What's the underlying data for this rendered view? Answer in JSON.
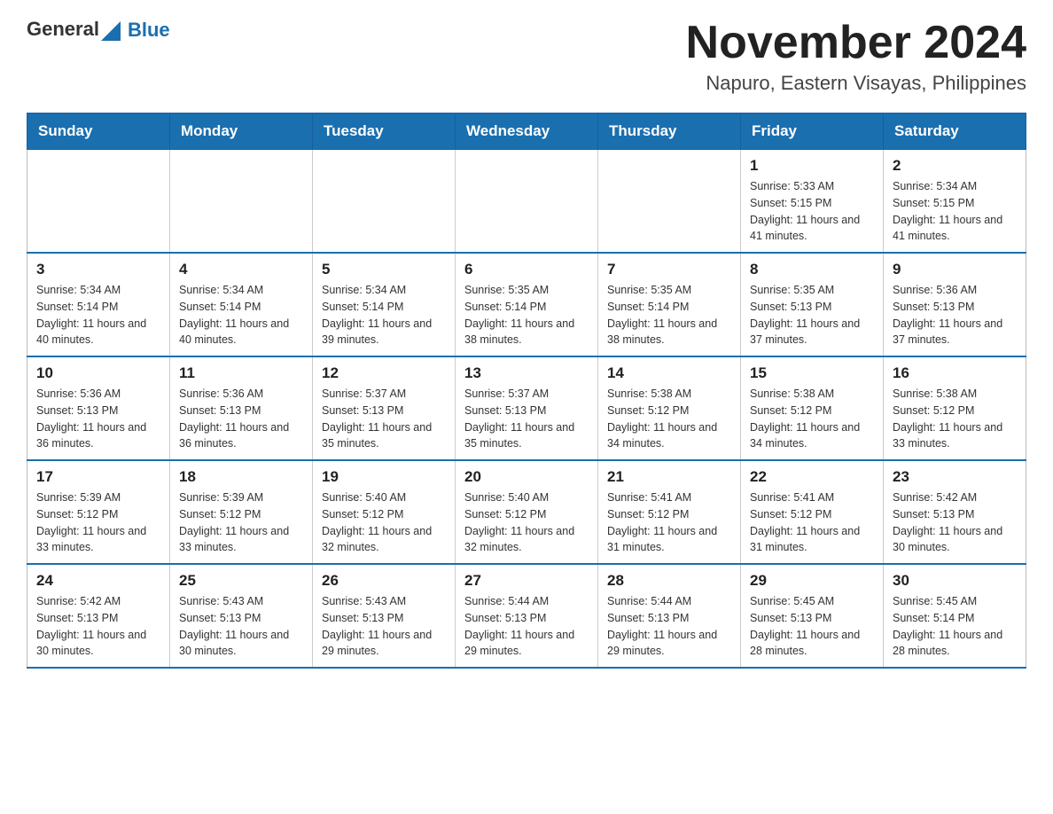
{
  "header": {
    "logo": {
      "general": "General",
      "blue": "Blue"
    },
    "title": "November 2024",
    "location": "Napuro, Eastern Visayas, Philippines"
  },
  "calendar": {
    "days_of_week": [
      "Sunday",
      "Monday",
      "Tuesday",
      "Wednesday",
      "Thursday",
      "Friday",
      "Saturday"
    ],
    "weeks": [
      [
        {
          "day": "",
          "info": ""
        },
        {
          "day": "",
          "info": ""
        },
        {
          "day": "",
          "info": ""
        },
        {
          "day": "",
          "info": ""
        },
        {
          "day": "",
          "info": ""
        },
        {
          "day": "1",
          "info": "Sunrise: 5:33 AM\nSunset: 5:15 PM\nDaylight: 11 hours and 41 minutes."
        },
        {
          "day": "2",
          "info": "Sunrise: 5:34 AM\nSunset: 5:15 PM\nDaylight: 11 hours and 41 minutes."
        }
      ],
      [
        {
          "day": "3",
          "info": "Sunrise: 5:34 AM\nSunset: 5:14 PM\nDaylight: 11 hours and 40 minutes."
        },
        {
          "day": "4",
          "info": "Sunrise: 5:34 AM\nSunset: 5:14 PM\nDaylight: 11 hours and 40 minutes."
        },
        {
          "day": "5",
          "info": "Sunrise: 5:34 AM\nSunset: 5:14 PM\nDaylight: 11 hours and 39 minutes."
        },
        {
          "day": "6",
          "info": "Sunrise: 5:35 AM\nSunset: 5:14 PM\nDaylight: 11 hours and 38 minutes."
        },
        {
          "day": "7",
          "info": "Sunrise: 5:35 AM\nSunset: 5:14 PM\nDaylight: 11 hours and 38 minutes."
        },
        {
          "day": "8",
          "info": "Sunrise: 5:35 AM\nSunset: 5:13 PM\nDaylight: 11 hours and 37 minutes."
        },
        {
          "day": "9",
          "info": "Sunrise: 5:36 AM\nSunset: 5:13 PM\nDaylight: 11 hours and 37 minutes."
        }
      ],
      [
        {
          "day": "10",
          "info": "Sunrise: 5:36 AM\nSunset: 5:13 PM\nDaylight: 11 hours and 36 minutes."
        },
        {
          "day": "11",
          "info": "Sunrise: 5:36 AM\nSunset: 5:13 PM\nDaylight: 11 hours and 36 minutes."
        },
        {
          "day": "12",
          "info": "Sunrise: 5:37 AM\nSunset: 5:13 PM\nDaylight: 11 hours and 35 minutes."
        },
        {
          "day": "13",
          "info": "Sunrise: 5:37 AM\nSunset: 5:13 PM\nDaylight: 11 hours and 35 minutes."
        },
        {
          "day": "14",
          "info": "Sunrise: 5:38 AM\nSunset: 5:12 PM\nDaylight: 11 hours and 34 minutes."
        },
        {
          "day": "15",
          "info": "Sunrise: 5:38 AM\nSunset: 5:12 PM\nDaylight: 11 hours and 34 minutes."
        },
        {
          "day": "16",
          "info": "Sunrise: 5:38 AM\nSunset: 5:12 PM\nDaylight: 11 hours and 33 minutes."
        }
      ],
      [
        {
          "day": "17",
          "info": "Sunrise: 5:39 AM\nSunset: 5:12 PM\nDaylight: 11 hours and 33 minutes."
        },
        {
          "day": "18",
          "info": "Sunrise: 5:39 AM\nSunset: 5:12 PM\nDaylight: 11 hours and 33 minutes."
        },
        {
          "day": "19",
          "info": "Sunrise: 5:40 AM\nSunset: 5:12 PM\nDaylight: 11 hours and 32 minutes."
        },
        {
          "day": "20",
          "info": "Sunrise: 5:40 AM\nSunset: 5:12 PM\nDaylight: 11 hours and 32 minutes."
        },
        {
          "day": "21",
          "info": "Sunrise: 5:41 AM\nSunset: 5:12 PM\nDaylight: 11 hours and 31 minutes."
        },
        {
          "day": "22",
          "info": "Sunrise: 5:41 AM\nSunset: 5:12 PM\nDaylight: 11 hours and 31 minutes."
        },
        {
          "day": "23",
          "info": "Sunrise: 5:42 AM\nSunset: 5:13 PM\nDaylight: 11 hours and 30 minutes."
        }
      ],
      [
        {
          "day": "24",
          "info": "Sunrise: 5:42 AM\nSunset: 5:13 PM\nDaylight: 11 hours and 30 minutes."
        },
        {
          "day": "25",
          "info": "Sunrise: 5:43 AM\nSunset: 5:13 PM\nDaylight: 11 hours and 30 minutes."
        },
        {
          "day": "26",
          "info": "Sunrise: 5:43 AM\nSunset: 5:13 PM\nDaylight: 11 hours and 29 minutes."
        },
        {
          "day": "27",
          "info": "Sunrise: 5:44 AM\nSunset: 5:13 PM\nDaylight: 11 hours and 29 minutes."
        },
        {
          "day": "28",
          "info": "Sunrise: 5:44 AM\nSunset: 5:13 PM\nDaylight: 11 hours and 29 minutes."
        },
        {
          "day": "29",
          "info": "Sunrise: 5:45 AM\nSunset: 5:13 PM\nDaylight: 11 hours and 28 minutes."
        },
        {
          "day": "30",
          "info": "Sunrise: 5:45 AM\nSunset: 5:14 PM\nDaylight: 11 hours and 28 minutes."
        }
      ]
    ]
  }
}
